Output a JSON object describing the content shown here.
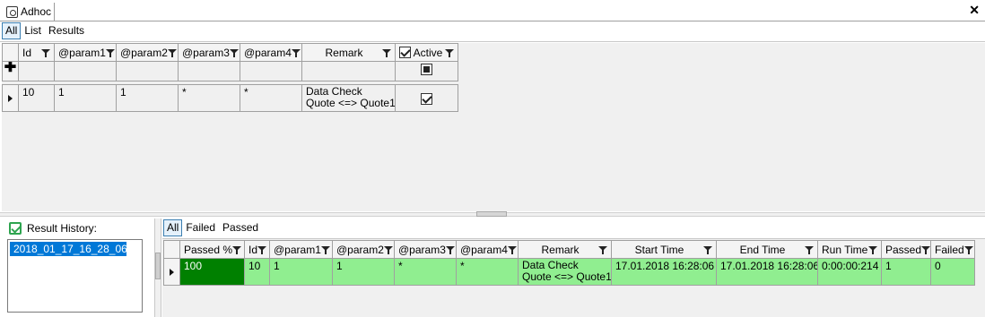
{
  "window": {
    "title": "Adhoc",
    "icon": "record-icon",
    "close_glyph": "✕"
  },
  "top_tabs": [
    "All",
    "List",
    "Results"
  ],
  "top_grid": {
    "columns": [
      "Id",
      "@param1",
      "@param2",
      "@param3",
      "@param4",
      "Remark",
      "Active"
    ],
    "rows": [
      {
        "id": "10",
        "param1": "1",
        "param2": "1",
        "param3": "*",
        "param4": "*",
        "remark_line1": "Data Check",
        "remark_line2": "Quote <=> Quote1",
        "active": true
      }
    ]
  },
  "result_history": {
    "label": "Result History:",
    "items": [
      "2018_01_17_16_28_06"
    ]
  },
  "bottom_tabs": [
    "All",
    "Failed",
    "Passed"
  ],
  "bottom_grid": {
    "columns": [
      "Passed %",
      "Id",
      "@param1",
      "@param2",
      "@param3",
      "@param4",
      "Remark",
      "Start Time",
      "End Time",
      "Run Time",
      "Passed",
      "Failed"
    ],
    "rows": [
      {
        "passed_pct": "100",
        "id": "10",
        "param1": "1",
        "param2": "1",
        "param3": "*",
        "param4": "*",
        "remark_line1": "Data Check",
        "remark_line2": "Quote <=> Quote1",
        "start": "17.01.2018 16:28:06",
        "end": "17.01.2018 16:28:06",
        "run": "0:00:00:214",
        "passed": "1",
        "failed": "0"
      }
    ]
  },
  "colors": {
    "pass_row": "#90ee90",
    "pass_pct": "#008000",
    "selection": "#0078d7",
    "active_tab": "#e5f1fb"
  }
}
